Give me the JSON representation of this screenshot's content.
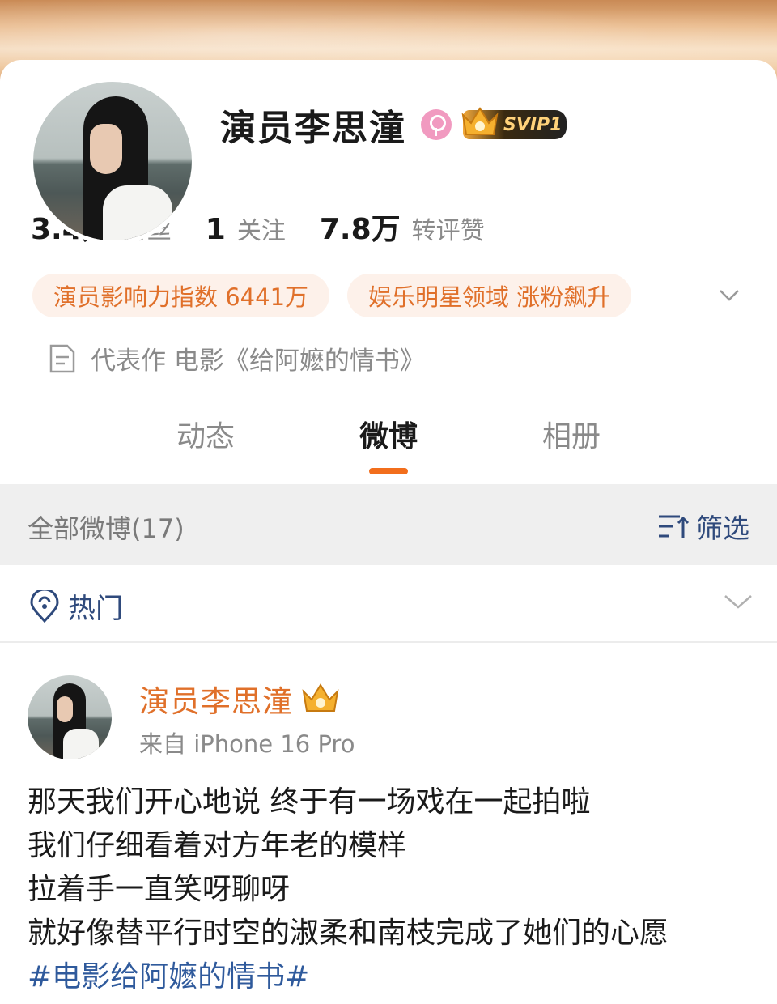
{
  "profile": {
    "name": "演员李思潼",
    "vip_badge": "SVIP1",
    "stats": [
      {
        "value": "3.4万",
        "label": "粉丝"
      },
      {
        "value": "1",
        "label": "关注"
      },
      {
        "value": "7.8万",
        "label": "转评赞"
      }
    ],
    "tags": [
      "演员影响力指数 6441万",
      "娱乐明星领域 涨粉飙升"
    ],
    "masterwork": "代表作 电影《给阿嬷的情书》"
  },
  "tabs": [
    {
      "label": "动态",
      "active": false
    },
    {
      "label": "微博",
      "active": true
    },
    {
      "label": "相册",
      "active": false
    }
  ],
  "filter": {
    "all_label": "全部微博(17)",
    "filter_label": "筛选"
  },
  "hot": {
    "label": "热门"
  },
  "post": {
    "author": "演员李思潼",
    "source": "来自 iPhone 16 Pro",
    "lines": [
      "那天我们开心地说 终于有一场戏在一起拍啦",
      "我们仔细看着对方年老的模样",
      "拉着手一直笑呀聊呀",
      "就好像替平行时空的淑柔和南枝完成了她们的心愿"
    ],
    "hashtag": "#电影给阿嬷的情书#"
  },
  "colors": {
    "accent_orange": "#f26e1c",
    "link_blue": "#2f5a9c",
    "tag_bg": "#fdf1ea"
  }
}
